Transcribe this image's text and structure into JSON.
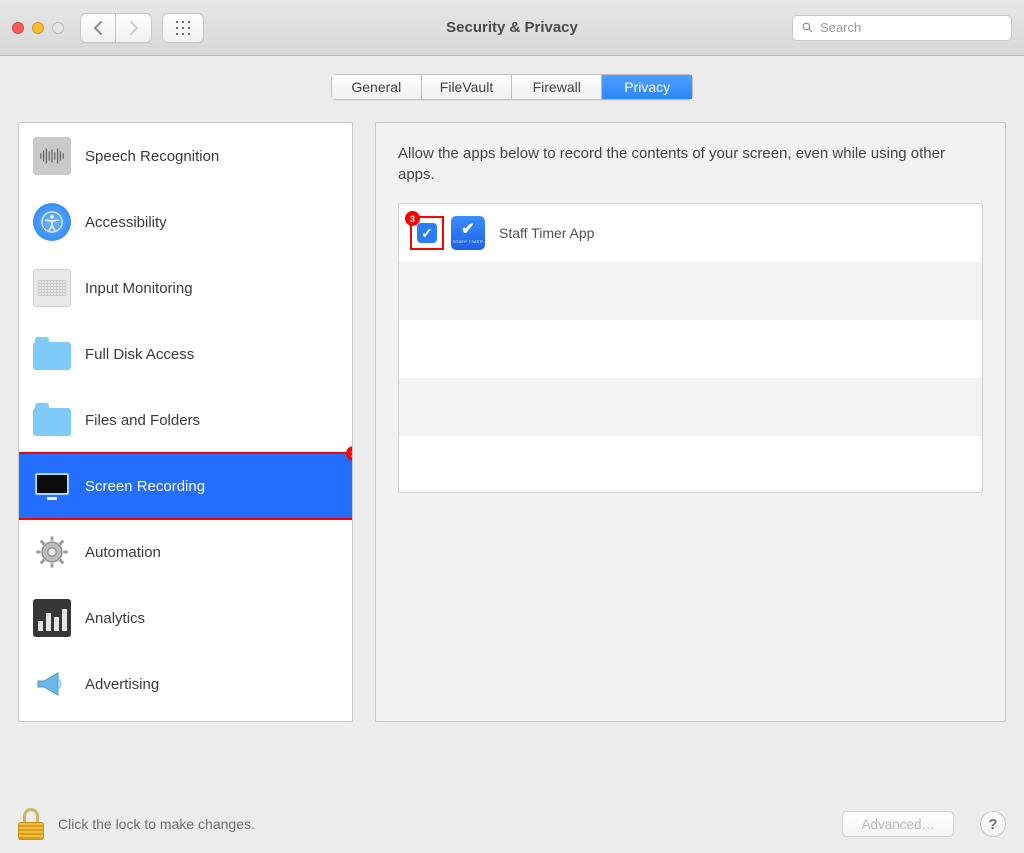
{
  "window": {
    "title": "Security & Privacy",
    "search_placeholder": "Search"
  },
  "tabs": [
    {
      "label": "General",
      "active": false
    },
    {
      "label": "FileVault",
      "active": false
    },
    {
      "label": "Firewall",
      "active": false
    },
    {
      "label": "Privacy",
      "active": true
    }
  ],
  "sidebar": {
    "items": [
      {
        "label": "Speech Recognition",
        "icon": "speech-waveform-icon"
      },
      {
        "label": "Accessibility",
        "icon": "accessibility-icon"
      },
      {
        "label": "Input Monitoring",
        "icon": "keyboard-icon"
      },
      {
        "label": "Full Disk Access",
        "icon": "folder-icon"
      },
      {
        "label": "Files and Folders",
        "icon": "folder-icon"
      },
      {
        "label": "Screen Recording",
        "icon": "monitor-icon",
        "selected": true
      },
      {
        "label": "Automation",
        "icon": "gear-icon"
      },
      {
        "label": "Analytics",
        "icon": "bar-chart-icon"
      },
      {
        "label": "Advertising",
        "icon": "megaphone-icon"
      }
    ]
  },
  "detail": {
    "description": "Allow the apps below to record the contents of your screen, even while using other apps.",
    "apps": [
      {
        "name": "Staff Timer App",
        "checked": true
      }
    ]
  },
  "footer": {
    "lock_text": "Click the lock to make changes.",
    "advanced_label": "Advanced…"
  },
  "annotations": {
    "1": "Privacy tab highlighted",
    "2": "Screen Recording highlighted",
    "3": "App checkbox highlighted"
  }
}
